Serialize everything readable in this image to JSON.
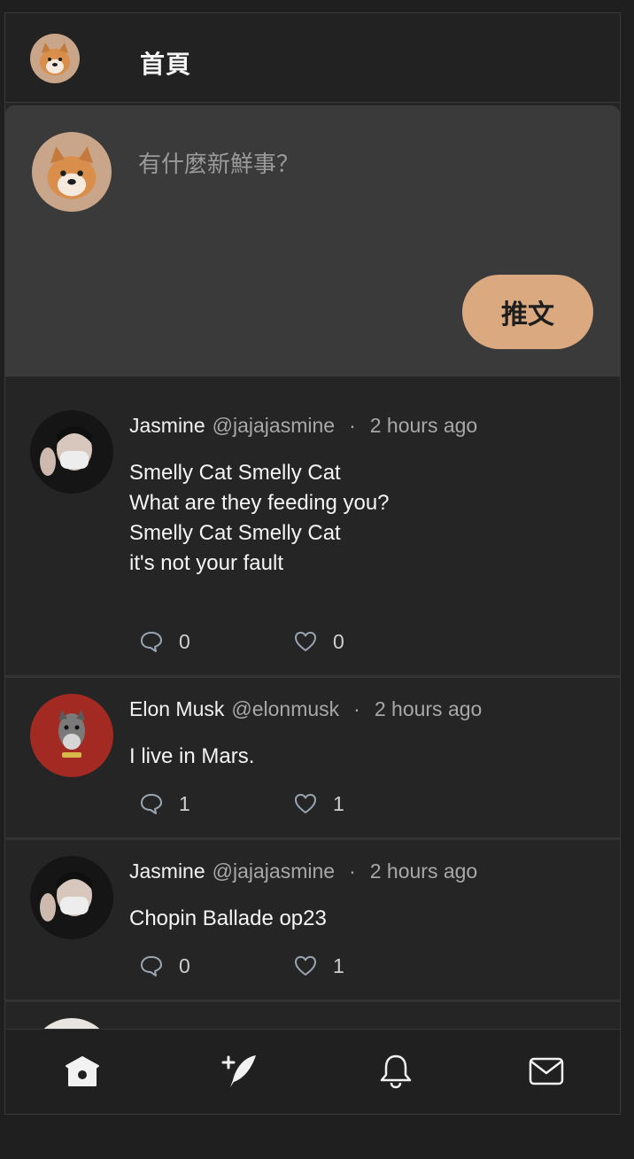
{
  "header": {
    "title": "首頁"
  },
  "compose": {
    "placeholder": "有什麼新鮮事？",
    "button_label": "推文"
  },
  "posts": [
    {
      "name": "Jasmine",
      "handle": "@jajajasmine",
      "dot": "·",
      "time": "2 hours ago",
      "body": " Smelly Cat Smelly Cat\nWhat are they feeding you?\nSmelly Cat Smelly Cat\nit's not your fault",
      "replies": "0",
      "likes": "0"
    },
    {
      "name": "Elon Musk",
      "handle": "@elonmusk",
      "dot": "·",
      "time": "2 hours ago",
      "body": " I live in Mars.",
      "replies": "1",
      "likes": "1"
    },
    {
      "name": "Jasmine",
      "handle": "@jajajasmine",
      "dot": "·",
      "time": "2 hours ago",
      "body": " Chopin Ballade op23",
      "replies": "0",
      "likes": "1"
    }
  ],
  "nav": {
    "icons": [
      "home-icon",
      "compose-tweet-icon",
      "bell-icon",
      "mail-icon"
    ]
  },
  "colors": {
    "accent": "#dba97f",
    "background": "#252526",
    "compose_bg": "#3a3a3b"
  }
}
